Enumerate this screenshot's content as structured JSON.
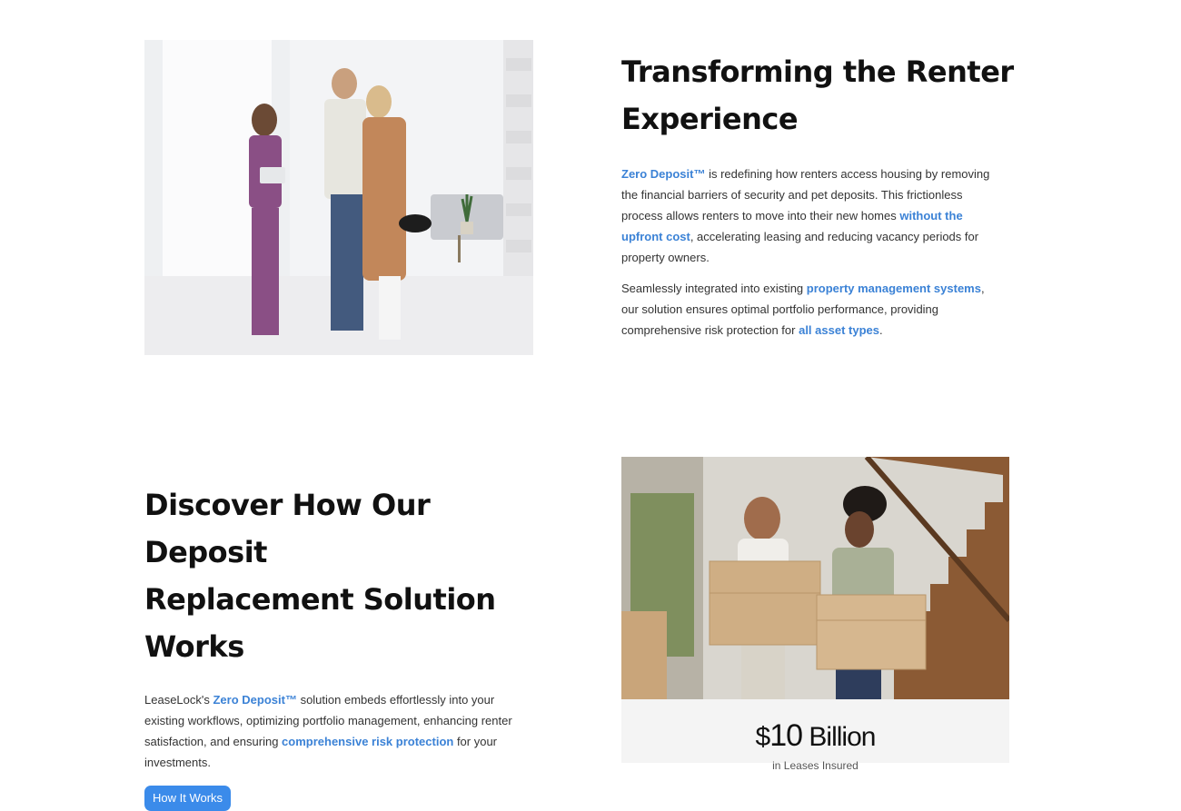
{
  "section1": {
    "image_alt": "Agent showing a couple around an apartment",
    "heading_line1": "Transforming the Renter",
    "heading_line2": "Experience",
    "p1": {
      "link1": "Zero Deposit™",
      "text1": " is redefining how renters access housing by removing the financial barriers of security and pet deposits. This frictionless process allows renters to move into their new homes ",
      "link2": "without the upfront cost",
      "text2": ", accelerating leasing and reducing vacancy periods for property owners."
    },
    "p2": {
      "text1": "Seamlessly integrated into existing ",
      "link1": "property management systems",
      "text2": ", our solution ensures optimal portfolio performance, providing comprehensive risk protection for ",
      "link2": "all asset types",
      "text3": "."
    }
  },
  "section2": {
    "heading_line1": "Discover How Our Deposit",
    "heading_line2": "Replacement Solution",
    "heading_line3": "Works",
    "p1": {
      "text1": "LeaseLock's ",
      "link1": "Zero Deposit™",
      "text2": " solution embeds effortlessly into your existing workflows, optimizing portfolio management, enhancing renter satisfaction, and ensuring ",
      "link2": "comprehensive risk protection",
      "text3": " for your investments."
    },
    "button_label": "How It Works",
    "image_alt": "Couple carrying moving boxes",
    "stat": {
      "prefix": "$",
      "number": "10",
      "suffix": " Billion",
      "label": "in Leases Insured"
    }
  },
  "colors": {
    "link": "#3b82d6",
    "button": "#3b8bea",
    "heading": "#111111"
  }
}
